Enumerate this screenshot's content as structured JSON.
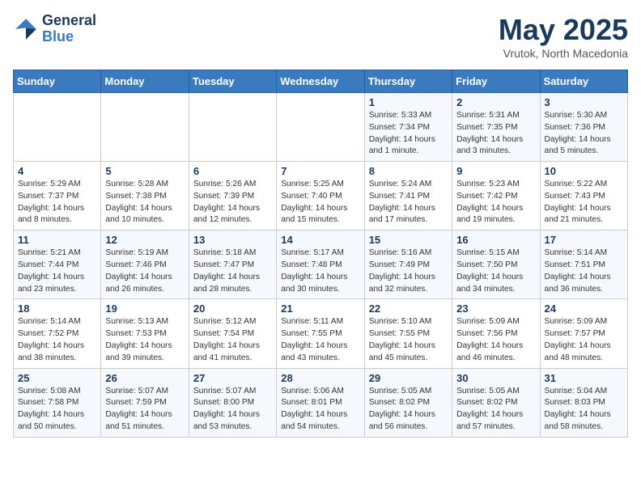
{
  "logo": {
    "general": "General",
    "blue": "Blue"
  },
  "title": "May 2025",
  "location": "Vrutok, North Macedonia",
  "days_of_week": [
    "Sunday",
    "Monday",
    "Tuesday",
    "Wednesday",
    "Thursday",
    "Friday",
    "Saturday"
  ],
  "weeks": [
    [
      {
        "day": "",
        "info": ""
      },
      {
        "day": "",
        "info": ""
      },
      {
        "day": "",
        "info": ""
      },
      {
        "day": "",
        "info": ""
      },
      {
        "day": "1",
        "info": "Sunrise: 5:33 AM\nSunset: 7:34 PM\nDaylight: 14 hours\nand 1 minute."
      },
      {
        "day": "2",
        "info": "Sunrise: 5:31 AM\nSunset: 7:35 PM\nDaylight: 14 hours\nand 3 minutes."
      },
      {
        "day": "3",
        "info": "Sunrise: 5:30 AM\nSunset: 7:36 PM\nDaylight: 14 hours\nand 5 minutes."
      }
    ],
    [
      {
        "day": "4",
        "info": "Sunrise: 5:29 AM\nSunset: 7:37 PM\nDaylight: 14 hours\nand 8 minutes."
      },
      {
        "day": "5",
        "info": "Sunrise: 5:28 AM\nSunset: 7:38 PM\nDaylight: 14 hours\nand 10 minutes."
      },
      {
        "day": "6",
        "info": "Sunrise: 5:26 AM\nSunset: 7:39 PM\nDaylight: 14 hours\nand 12 minutes."
      },
      {
        "day": "7",
        "info": "Sunrise: 5:25 AM\nSunset: 7:40 PM\nDaylight: 14 hours\nand 15 minutes."
      },
      {
        "day": "8",
        "info": "Sunrise: 5:24 AM\nSunset: 7:41 PM\nDaylight: 14 hours\nand 17 minutes."
      },
      {
        "day": "9",
        "info": "Sunrise: 5:23 AM\nSunset: 7:42 PM\nDaylight: 14 hours\nand 19 minutes."
      },
      {
        "day": "10",
        "info": "Sunrise: 5:22 AM\nSunset: 7:43 PM\nDaylight: 14 hours\nand 21 minutes."
      }
    ],
    [
      {
        "day": "11",
        "info": "Sunrise: 5:21 AM\nSunset: 7:44 PM\nDaylight: 14 hours\nand 23 minutes."
      },
      {
        "day": "12",
        "info": "Sunrise: 5:19 AM\nSunset: 7:46 PM\nDaylight: 14 hours\nand 26 minutes."
      },
      {
        "day": "13",
        "info": "Sunrise: 5:18 AM\nSunset: 7:47 PM\nDaylight: 14 hours\nand 28 minutes."
      },
      {
        "day": "14",
        "info": "Sunrise: 5:17 AM\nSunset: 7:48 PM\nDaylight: 14 hours\nand 30 minutes."
      },
      {
        "day": "15",
        "info": "Sunrise: 5:16 AM\nSunset: 7:49 PM\nDaylight: 14 hours\nand 32 minutes."
      },
      {
        "day": "16",
        "info": "Sunrise: 5:15 AM\nSunset: 7:50 PM\nDaylight: 14 hours\nand 34 minutes."
      },
      {
        "day": "17",
        "info": "Sunrise: 5:14 AM\nSunset: 7:51 PM\nDaylight: 14 hours\nand 36 minutes."
      }
    ],
    [
      {
        "day": "18",
        "info": "Sunrise: 5:14 AM\nSunset: 7:52 PM\nDaylight: 14 hours\nand 38 minutes."
      },
      {
        "day": "19",
        "info": "Sunrise: 5:13 AM\nSunset: 7:53 PM\nDaylight: 14 hours\nand 39 minutes."
      },
      {
        "day": "20",
        "info": "Sunrise: 5:12 AM\nSunset: 7:54 PM\nDaylight: 14 hours\nand 41 minutes."
      },
      {
        "day": "21",
        "info": "Sunrise: 5:11 AM\nSunset: 7:55 PM\nDaylight: 14 hours\nand 43 minutes."
      },
      {
        "day": "22",
        "info": "Sunrise: 5:10 AM\nSunset: 7:55 PM\nDaylight: 14 hours\nand 45 minutes."
      },
      {
        "day": "23",
        "info": "Sunrise: 5:09 AM\nSunset: 7:56 PM\nDaylight: 14 hours\nand 46 minutes."
      },
      {
        "day": "24",
        "info": "Sunrise: 5:09 AM\nSunset: 7:57 PM\nDaylight: 14 hours\nand 48 minutes."
      }
    ],
    [
      {
        "day": "25",
        "info": "Sunrise: 5:08 AM\nSunset: 7:58 PM\nDaylight: 14 hours\nand 50 minutes."
      },
      {
        "day": "26",
        "info": "Sunrise: 5:07 AM\nSunset: 7:59 PM\nDaylight: 14 hours\nand 51 minutes."
      },
      {
        "day": "27",
        "info": "Sunrise: 5:07 AM\nSunset: 8:00 PM\nDaylight: 14 hours\nand 53 minutes."
      },
      {
        "day": "28",
        "info": "Sunrise: 5:06 AM\nSunset: 8:01 PM\nDaylight: 14 hours\nand 54 minutes."
      },
      {
        "day": "29",
        "info": "Sunrise: 5:05 AM\nSunset: 8:02 PM\nDaylight: 14 hours\nand 56 minutes."
      },
      {
        "day": "30",
        "info": "Sunrise: 5:05 AM\nSunset: 8:02 PM\nDaylight: 14 hours\nand 57 minutes."
      },
      {
        "day": "31",
        "info": "Sunrise: 5:04 AM\nSunset: 8:03 PM\nDaylight: 14 hours\nand 58 minutes."
      }
    ]
  ]
}
